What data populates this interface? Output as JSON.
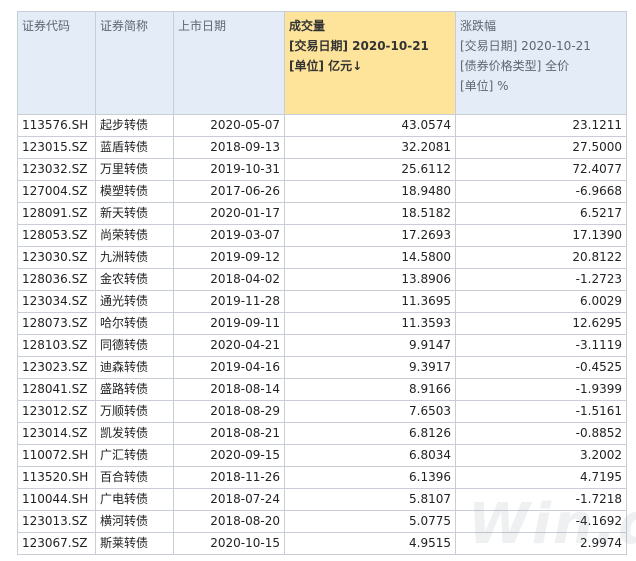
{
  "headers": {
    "code": "证券代码",
    "name": "证券简称",
    "listdate": "上市日期",
    "volume": [
      "成交量",
      "[交易日期] 2020-10-21",
      "[单位] 亿元↓"
    ],
    "change": [
      "涨跌幅",
      "[交易日期] 2020-10-21",
      "[债券价格类型] 全价",
      "[单位] %"
    ]
  },
  "rows": [
    {
      "code": "113576.SH",
      "name": "起步转债",
      "date": "2020-05-07",
      "volume": "43.0574",
      "change": "23.1211"
    },
    {
      "code": "123015.SZ",
      "name": "蓝盾转债",
      "date": "2018-09-13",
      "volume": "32.2081",
      "change": "27.5000"
    },
    {
      "code": "123032.SZ",
      "name": "万里转债",
      "date": "2019-10-31",
      "volume": "25.6112",
      "change": "72.4077"
    },
    {
      "code": "127004.SZ",
      "name": "模塑转债",
      "date": "2017-06-26",
      "volume": "18.9480",
      "change": "-6.9668"
    },
    {
      "code": "128091.SZ",
      "name": "新天转债",
      "date": "2020-01-17",
      "volume": "18.5182",
      "change": "6.5217"
    },
    {
      "code": "128053.SZ",
      "name": "尚荣转债",
      "date": "2019-03-07",
      "volume": "17.2693",
      "change": "17.1390"
    },
    {
      "code": "123030.SZ",
      "name": "九洲转债",
      "date": "2019-09-12",
      "volume": "14.5800",
      "change": "20.8122"
    },
    {
      "code": "128036.SZ",
      "name": "金农转债",
      "date": "2018-04-02",
      "volume": "13.8906",
      "change": "-1.2723"
    },
    {
      "code": "123034.SZ",
      "name": "通光转债",
      "date": "2019-11-28",
      "volume": "11.3695",
      "change": "6.0029"
    },
    {
      "code": "128073.SZ",
      "name": "哈尔转债",
      "date": "2019-09-11",
      "volume": "11.3593",
      "change": "12.6295"
    },
    {
      "code": "128103.SZ",
      "name": "同德转债",
      "date": "2020-04-21",
      "volume": "9.9147",
      "change": "-3.1119"
    },
    {
      "code": "123023.SZ",
      "name": "迪森转债",
      "date": "2019-04-16",
      "volume": "9.3917",
      "change": "-0.4525"
    },
    {
      "code": "128041.SZ",
      "name": "盛路转债",
      "date": "2018-08-14",
      "volume": "8.9166",
      "change": "-1.9399"
    },
    {
      "code": "123012.SZ",
      "name": "万顺转债",
      "date": "2018-08-29",
      "volume": "7.6503",
      "change": "-1.5161"
    },
    {
      "code": "123014.SZ",
      "name": "凯发转债",
      "date": "2018-08-21",
      "volume": "6.8126",
      "change": "-0.8852"
    },
    {
      "code": "110072.SH",
      "name": "广汇转债",
      "date": "2020-09-15",
      "volume": "6.8034",
      "change": "3.2002"
    },
    {
      "code": "113520.SH",
      "name": "百合转债",
      "date": "2018-11-26",
      "volume": "6.1396",
      "change": "4.7195"
    },
    {
      "code": "110044.SH",
      "name": "广电转债",
      "date": "2018-07-24",
      "volume": "5.8107",
      "change": "-1.7218"
    },
    {
      "code": "123013.SZ",
      "name": "横河转债",
      "date": "2018-08-20",
      "volume": "5.0775",
      "change": "-4.1692"
    },
    {
      "code": "123067.SZ",
      "name": "斯莱转债",
      "date": "2020-10-15",
      "volume": "4.9515",
      "change": "2.9974"
    }
  ],
  "watermark": "Win.d"
}
